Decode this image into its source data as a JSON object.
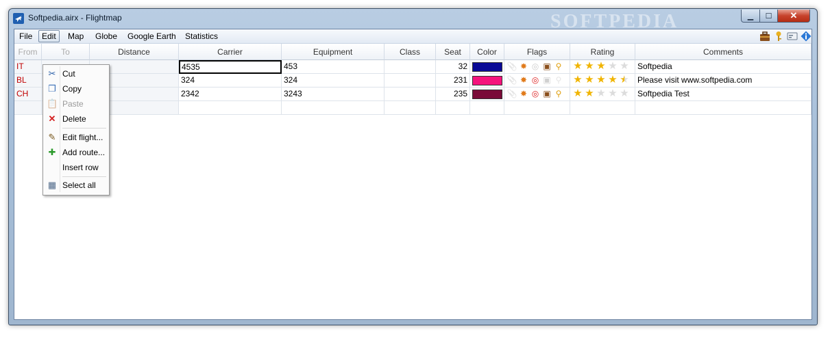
{
  "window": {
    "title": "Softpedia.airx - Flightmap",
    "watermark": "SOFTPEDIA",
    "min_label": "▁",
    "max_label": "☐",
    "close_label": "✕"
  },
  "menu": {
    "items": [
      "File",
      "Edit",
      "Map",
      "Globe",
      "Google Earth",
      "Statistics"
    ]
  },
  "toolbar_icons": [
    "luggage-icon",
    "key-icon",
    "card-icon",
    "info-icon"
  ],
  "table": {
    "columns": [
      "From",
      "To",
      "Distance",
      "Carrier",
      "Equipment",
      "Class",
      "Seat",
      "Color",
      "Flags",
      "Rating",
      "Comments"
    ],
    "rows": [
      {
        "from": "IT",
        "carrier": "4535",
        "equipment": "453",
        "class": "",
        "seat": "32",
        "color": "#0a0a96",
        "flags": [
          0,
          1,
          0,
          1,
          1
        ],
        "rating": 3,
        "comment": "Softpedia"
      },
      {
        "from": "BL",
        "carrier": "324",
        "equipment": "324",
        "class": "",
        "seat": "231",
        "color": "#f5137c",
        "flags": [
          0,
          1,
          1,
          0,
          0
        ],
        "rating": 4.5,
        "comment": "Please visit www.softpedia.com"
      },
      {
        "from": "CH",
        "carrier": "2342",
        "equipment": "3243",
        "class": "",
        "seat": "235",
        "color": "#7a0b38",
        "flags": [
          0,
          1,
          1,
          1,
          1
        ],
        "rating": 2,
        "comment": "Softpedia Test"
      }
    ]
  },
  "edit_menu": {
    "items": [
      {
        "label": "Cut",
        "icon": "scissors-icon",
        "glyph": "✂",
        "disabled": false
      },
      {
        "label": "Copy",
        "icon": "copy-icon",
        "glyph": "❐",
        "disabled": false
      },
      {
        "label": "Paste",
        "icon": "paste-icon",
        "glyph": "📋",
        "disabled": true
      },
      {
        "label": "Delete",
        "icon": "delete-icon",
        "glyph": "✕",
        "disabled": false
      },
      {
        "label": "Edit flight...",
        "icon": "edit-icon",
        "glyph": "✎",
        "disabled": false
      },
      {
        "label": "Add route...",
        "icon": "add-icon",
        "glyph": "✚",
        "disabled": false
      },
      {
        "label": "Insert row",
        "icon": "",
        "glyph": "",
        "disabled": false
      },
      {
        "label": "Select all",
        "icon": "select-all-icon",
        "glyph": "▦",
        "disabled": false
      }
    ]
  }
}
